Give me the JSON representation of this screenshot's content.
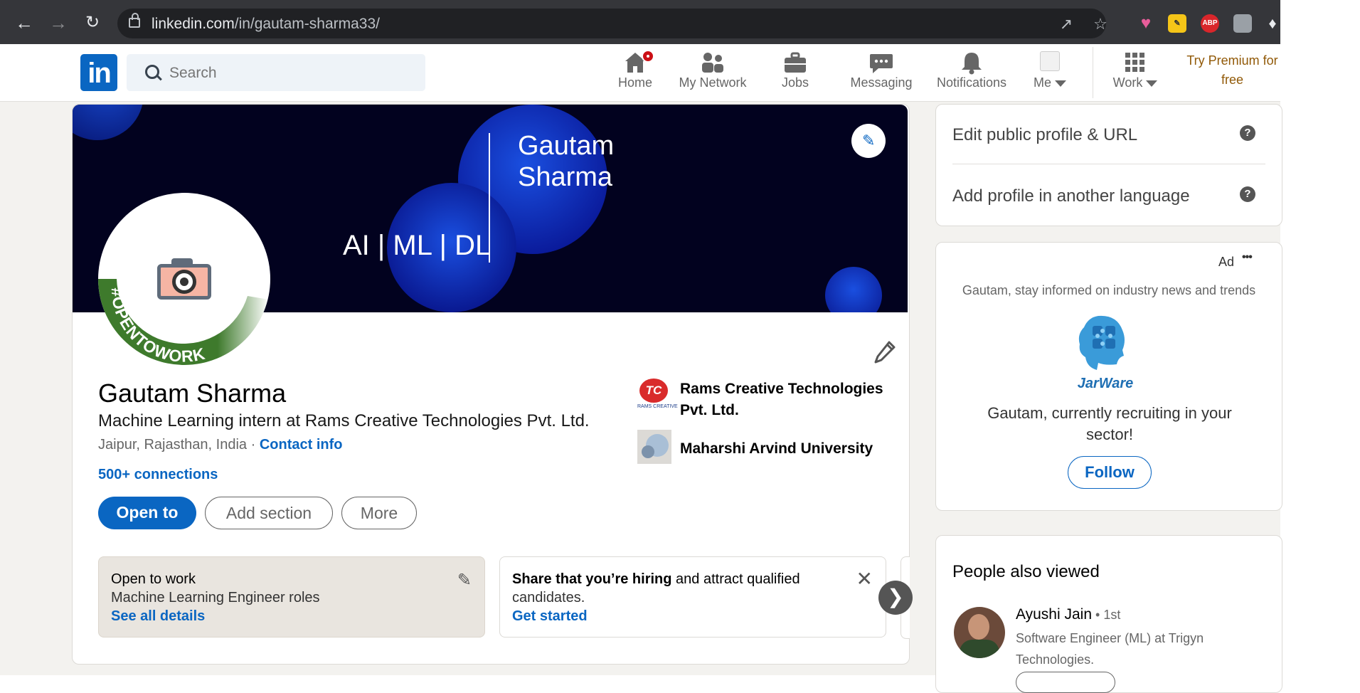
{
  "browser": {
    "url_host": "linkedin.com",
    "url_path": "/in/gautam-sharma33/",
    "ext_abp": "ABP"
  },
  "header": {
    "logo": "in",
    "search_placeholder": "Search",
    "nav": [
      {
        "label": "Home",
        "icon": "home-icon"
      },
      {
        "label": "My Network",
        "icon": "people-icon"
      },
      {
        "label": "Jobs",
        "icon": "briefcase-icon"
      },
      {
        "label": "Messaging",
        "icon": "chat-icon"
      },
      {
        "label": "Notifications",
        "icon": "bell-icon"
      },
      {
        "label": "Me",
        "icon": "avatar-icon"
      },
      {
        "label": "Work",
        "icon": "grid-icon"
      }
    ],
    "premium": "Try Premium for free"
  },
  "banner": {
    "name_line1": "Gautam",
    "name_line2": "Sharma",
    "tagline": "AI | ML | DL"
  },
  "profile": {
    "open_to_work_frame": "#OPENTOWORK",
    "name": "Gautam Sharma",
    "headline": "Machine Learning intern at Rams Creative Technologies Pvt. Ltd.",
    "location": "Jaipur, Rajasthan, India",
    "location_sep": " · ",
    "contact_info": "Contact info",
    "connections": "500+ connections",
    "buttons": {
      "open_to": "Open to",
      "add_section": "Add section",
      "more": "More"
    },
    "organizations": [
      {
        "name": "Rams Creative Technologies Pvt. Ltd.",
        "logo_text": "RAMS CREATIVE"
      },
      {
        "name": "Maharshi Arvind University"
      }
    ]
  },
  "cards": {
    "open_to_work": {
      "title": "Open to work",
      "roles": "Machine Learning Engineer roles",
      "link": "See all details"
    },
    "hiring": {
      "title_bold": "Share that you’re hiring",
      "title_rest": " and attract qualified",
      "line2": "candidates.",
      "link": "Get started"
    }
  },
  "sidebar": {
    "edit_public_profile": "Edit public profile & URL",
    "add_language": "Add profile in another language",
    "ad": {
      "label": "Ad",
      "more": "•••",
      "subtitle": "Gautam, stay informed on industry news and trends",
      "brand": "JarWare",
      "message": "Gautam, currently recruiting in your sector!",
      "follow": "Follow"
    },
    "people_also_viewed": {
      "title": "People also viewed",
      "people": [
        {
          "name": "Ayushi Jain",
          "degree": " • 1st",
          "headline": "Software Engineer (ML) at Trigyn Technologies."
        }
      ]
    }
  },
  "colors": {
    "linkedin_blue": "#0a66c2",
    "opentowork_green": "#3e7a2c",
    "banner_bg": "#02021f",
    "premium_gold": "#915907"
  }
}
